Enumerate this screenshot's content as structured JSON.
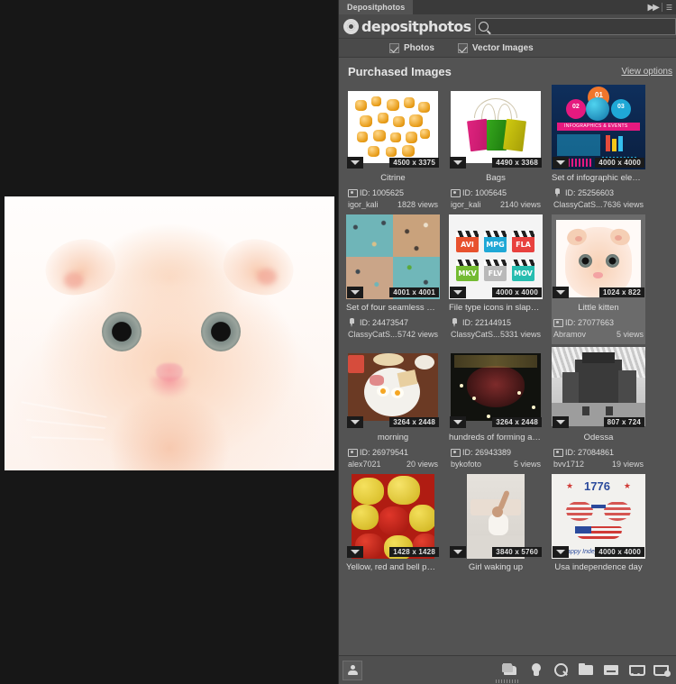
{
  "window": {
    "tab_label": "Depositphotos",
    "collapse_icon": "double-right-chevron-icon"
  },
  "brand": {
    "name": "depositphotos",
    "logo_icon": "camera-lens-icon"
  },
  "search": {
    "value": "",
    "placeholder": "",
    "icon": "search-icon"
  },
  "filters": [
    {
      "label": "Photos",
      "checked": true
    },
    {
      "label": "Vector Images",
      "checked": true
    }
  ],
  "section": {
    "title": "Purchased Images",
    "view_options_label": "View options"
  },
  "items": [
    {
      "title": "Citrine",
      "dimensions": "4500 x 3375",
      "id_label": "ID: 1005625",
      "author": "igor_kali",
      "views": "1828 views",
      "type": "photo",
      "selected": false
    },
    {
      "title": "Bags",
      "dimensions": "4490 x 3368",
      "id_label": "ID: 1005645",
      "author": "igor_kali",
      "views": "2140 views",
      "type": "photo",
      "selected": false
    },
    {
      "title": "Set of infographic eleme...",
      "dimensions": "4000 x 4000",
      "id_label": "ID: 25256603",
      "author": "ClassyCatS...",
      "views": "7636 views",
      "type": "vector",
      "selected": false
    },
    {
      "title": "Set of four seamless bac...",
      "dimensions": "4001 x 4001",
      "id_label": "ID: 24473547",
      "author": "ClassyCatS...",
      "views": "5742 views",
      "type": "vector",
      "selected": false
    },
    {
      "title": "File type icons in slapstic...",
      "dimensions": "4000 x 4000",
      "id_label": "ID: 22144915",
      "author": "ClassyCatS...",
      "views": "5331 views",
      "type": "vector",
      "selected": false
    },
    {
      "title": "Little kitten",
      "dimensions": "1024 x 822",
      "id_label": "ID: 27077663",
      "author": "Abramov",
      "views": "5 views",
      "type": "photo",
      "selected": true
    },
    {
      "title": "morning",
      "dimensions": "3264 x 2448",
      "id_label": "ID: 26979541",
      "author": "alex7021",
      "views": "20 views",
      "type": "photo",
      "selected": false
    },
    {
      "title": "hundreds of forming a h..",
      "dimensions": "3264 x 2448",
      "id_label": "ID: 26943389",
      "author": "bykofoto",
      "views": "5 views",
      "type": "photo",
      "selected": false
    },
    {
      "title": "Odessa",
      "dimensions": "807 x 724",
      "id_label": "ID: 27084861",
      "author": "bvv1712",
      "views": "19 views",
      "type": "photo",
      "selected": false
    },
    {
      "title": "Yellow, red and bell pepper",
      "dimensions": "1428 x 1428",
      "id_label": "",
      "author": "",
      "views": "",
      "type": "photo",
      "selected": false
    },
    {
      "title": "Girl waking up",
      "dimensions": "3840 x 5760",
      "id_label": "",
      "author": "",
      "views": "",
      "type": "photo",
      "selected": false
    },
    {
      "title": "Usa independence day",
      "dimensions": "4000 x 4000",
      "id_label": "",
      "author": "",
      "views": "",
      "type": "vector",
      "selected": false
    }
  ],
  "artwork": {
    "infographic_banner": "INFOGRAPHICS & EVENTS",
    "infographic_steps": [
      "01",
      "02",
      "03"
    ],
    "filetypes": [
      "AVI",
      "MPG",
      "FLA",
      "MKV",
      "FLV",
      "MOV"
    ],
    "independence_year": "1776",
    "independence_caption": "Happy Independence Day"
  },
  "bottom_toolbar": {
    "account_icon": "user-account-icon",
    "tools": [
      "folders-icon",
      "lightbulb-icon",
      "search-icon",
      "folder-icon",
      "folder-lines-icon",
      "cart-icon",
      "cart-download-icon"
    ]
  },
  "document": {
    "image_alt": "little-kitten-photo"
  }
}
